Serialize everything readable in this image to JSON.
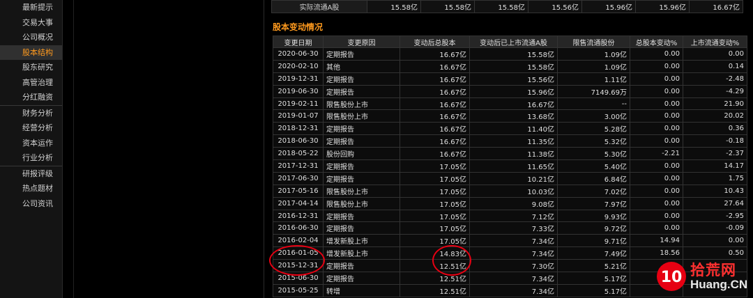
{
  "sidebar": {
    "items": [
      {
        "label": "最新提示",
        "active": false
      },
      {
        "label": "交易大事",
        "active": false
      },
      {
        "label": "公司概况",
        "active": false
      },
      {
        "label": "股本结构",
        "active": true
      },
      {
        "label": "股东研究",
        "active": false
      },
      {
        "label": "高管治理",
        "active": false
      },
      {
        "label": "分红融资",
        "active": false
      },
      {
        "label": "财务分析",
        "active": false
      },
      {
        "label": "经营分析",
        "active": false
      },
      {
        "label": "资本运作",
        "active": false
      },
      {
        "label": "行业分析",
        "active": false
      },
      {
        "label": "研报评级",
        "active": false
      },
      {
        "label": "热点题材",
        "active": false
      },
      {
        "label": "公司资讯",
        "active": false
      }
    ]
  },
  "float_row": {
    "label": "实际流通A股",
    "values": [
      "15.58亿",
      "15.58亿",
      "15.58亿",
      "15.56亿",
      "15.96亿",
      "15.96亿",
      "16.67亿"
    ]
  },
  "section_title": "股本变动情况",
  "changes": {
    "headers": [
      "变更日期",
      "变更原因",
      "变动后总股本",
      "变动后已上市流通A股",
      "限售流通股份",
      "总股本变动%",
      "上市流通变动%"
    ],
    "rows": [
      [
        "2020-06-30",
        "定期报告",
        "16.67亿",
        "15.58亿",
        "1.09亿",
        "0.00",
        "0.00"
      ],
      [
        "2020-02-10",
        "其他",
        "16.67亿",
        "15.58亿",
        "1.09亿",
        "0.00",
        "0.14"
      ],
      [
        "2019-12-31",
        "定期报告",
        "16.67亿",
        "15.56亿",
        "1.11亿",
        "0.00",
        "-2.48"
      ],
      [
        "2019-06-30",
        "定期报告",
        "16.67亿",
        "15.96亿",
        "7149.69万",
        "0.00",
        "-4.29"
      ],
      [
        "2019-02-11",
        "限售股份上市",
        "16.67亿",
        "16.67亿",
        "--",
        "0.00",
        "21.90"
      ],
      [
        "2019-01-07",
        "限售股份上市",
        "16.67亿",
        "13.68亿",
        "3.00亿",
        "0.00",
        "20.02"
      ],
      [
        "2018-12-31",
        "定期报告",
        "16.67亿",
        "11.40亿",
        "5.28亿",
        "0.00",
        "0.36"
      ],
      [
        "2018-06-30",
        "定期报告",
        "16.67亿",
        "11.35亿",
        "5.32亿",
        "0.00",
        "-0.18"
      ],
      [
        "2018-05-22",
        "股份回购",
        "16.67亿",
        "11.38亿",
        "5.30亿",
        "-2.21",
        "-2.37"
      ],
      [
        "2017-12-31",
        "定期报告",
        "17.05亿",
        "11.65亿",
        "5.40亿",
        "0.00",
        "14.17"
      ],
      [
        "2017-06-30",
        "定期报告",
        "17.05亿",
        "10.21亿",
        "6.84亿",
        "0.00",
        "1.75"
      ],
      [
        "2017-05-16",
        "限售股份上市",
        "17.05亿",
        "10.03亿",
        "7.02亿",
        "0.00",
        "10.43"
      ],
      [
        "2017-04-14",
        "限售股份上市",
        "17.05亿",
        "9.08亿",
        "7.97亿",
        "0.00",
        "27.64"
      ],
      [
        "2016-12-31",
        "定期报告",
        "17.05亿",
        "7.12亿",
        "9.93亿",
        "0.00",
        "-2.95"
      ],
      [
        "2016-06-30",
        "定期报告",
        "17.05亿",
        "7.33亿",
        "9.72亿",
        "0.00",
        "-0.09"
      ],
      [
        "2016-02-04",
        "增发新股上市",
        "17.05亿",
        "7.34亿",
        "9.71亿",
        "14.94",
        "0.00"
      ],
      [
        "2016-01-05",
        "增发新股上市",
        "14.83亿",
        "7.34亿",
        "7.49亿",
        "18.56",
        "0.50"
      ],
      [
        "2015-12-31",
        "定期报告",
        "12.51亿",
        "7.30亿",
        "5.21亿",
        "",
        ""
      ],
      [
        "2015-06-30",
        "定期报告",
        "12.51亿",
        "7.34亿",
        "5.17亿",
        "",
        ""
      ],
      [
        "2015-05-25",
        "转增",
        "12.51亿",
        "7.34亿",
        "5.17亿",
        "",
        ""
      ]
    ]
  },
  "watermark": {
    "logo_text": "10",
    "line1": "拾荒网",
    "line2": "Huang.CN"
  },
  "colors": {
    "accent": "#ff9a1e",
    "annotation": "#e60012"
  }
}
